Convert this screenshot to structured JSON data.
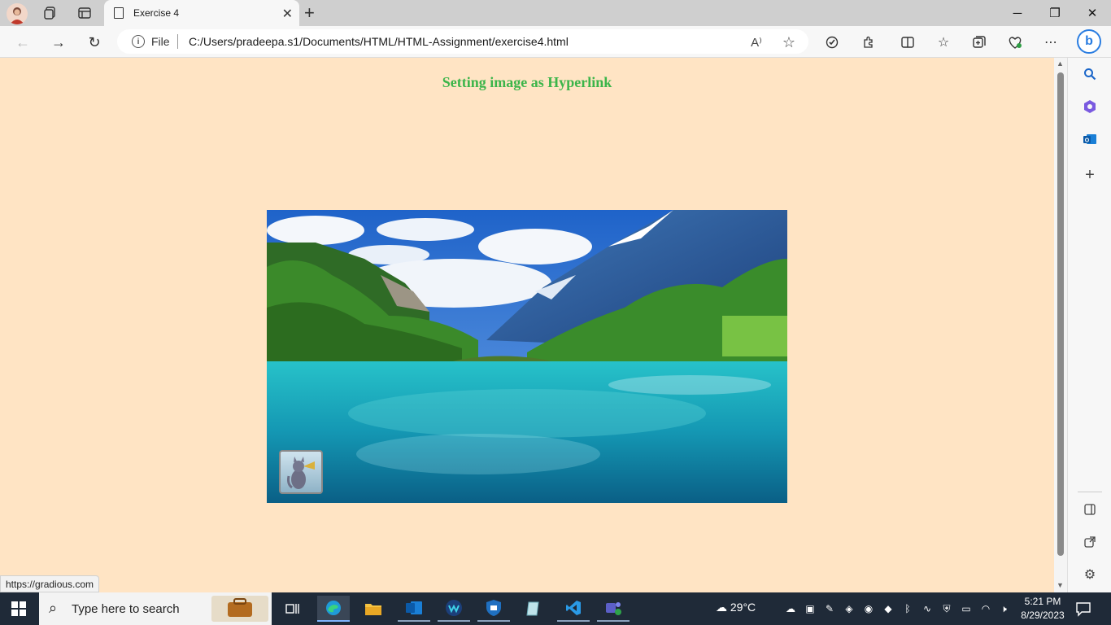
{
  "window": {
    "tab_title": "Exercise 4",
    "new_tab_symbol": "+",
    "tab_close_symbol": "✕",
    "minimize_symbol": "─",
    "restore_symbol": "❐",
    "close_symbol": "✕"
  },
  "address_bar": {
    "scheme_label": "File",
    "url": "C:/Users/pradeepa.s1/Documents/HTML/HTML-Assignment/exercise4.html",
    "read_aloud_label": "A⁾",
    "favorite_symbol": "☆"
  },
  "page": {
    "heading": "Setting image as Hyperlink",
    "background_color": "#ffe4c4",
    "heading_color": "#3cb54a"
  },
  "status_bar": {
    "hover_url": "https://gradious.com"
  },
  "taskbar": {
    "search_placeholder": "Type here to search",
    "weather_temp": "29°C",
    "time": "5:21 PM",
    "date": "8/29/2023"
  },
  "icons": {
    "profile": "profile-avatar",
    "workspaces": "workspaces-icon",
    "tab_actions": "tab-actions-icon",
    "back": "back-arrow-icon",
    "forward": "forward-arrow-icon",
    "refresh": "refresh-icon",
    "extensions": "extensions-icon",
    "split_screen": "split-screen-icon",
    "favorites": "favorites-icon",
    "collections": "collections-icon",
    "performance": "performance-icon",
    "more": "more-icon",
    "bing": "bing-copilot-icon"
  }
}
